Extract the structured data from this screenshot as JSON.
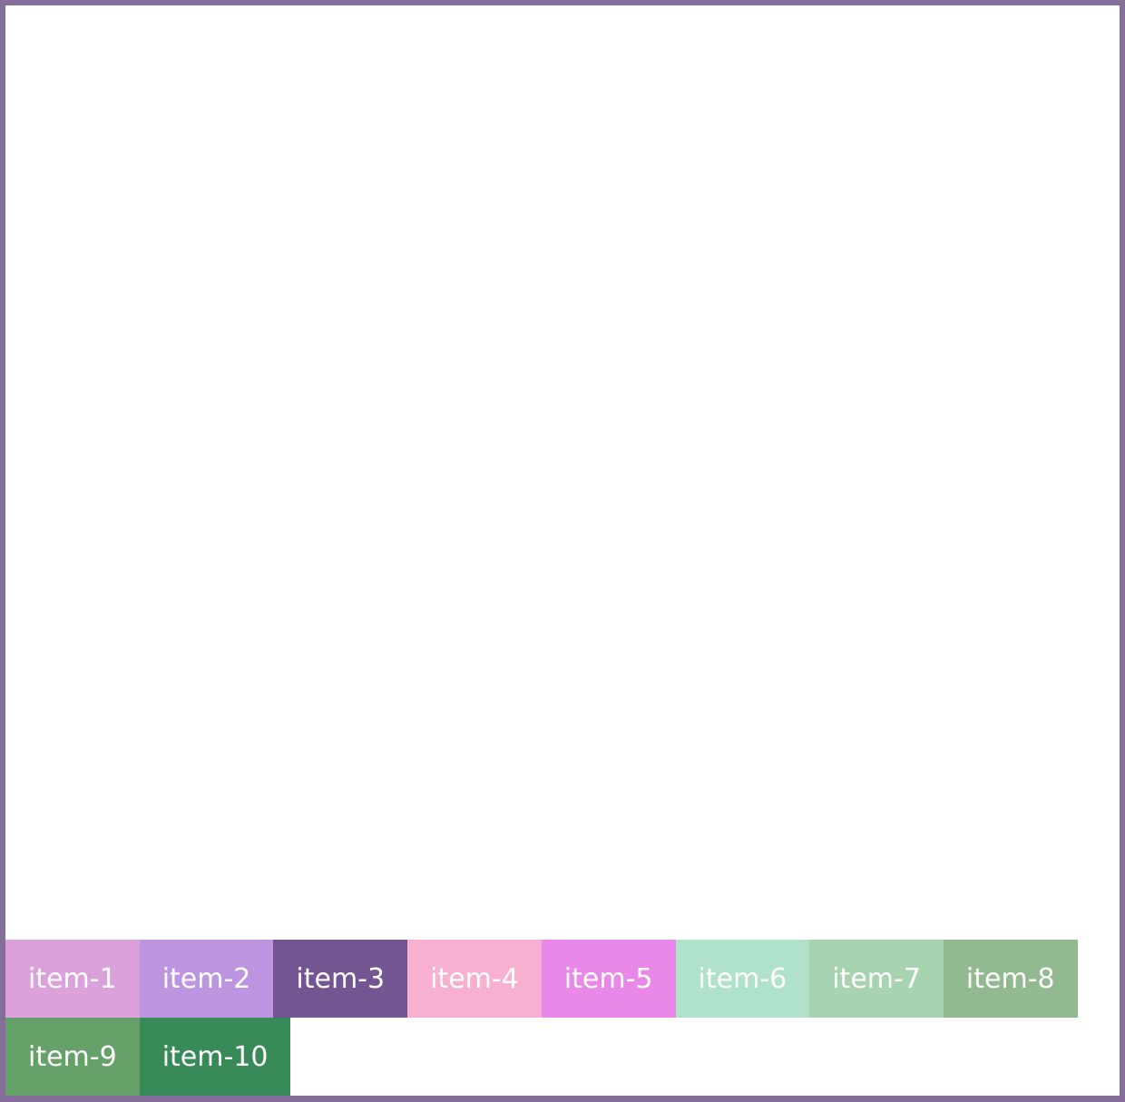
{
  "container": {
    "border_color": "#856e99",
    "background": "#ffffff"
  },
  "items": [
    {
      "label": "item-1",
      "color": "#dba1da"
    },
    {
      "label": "item-2",
      "color": "#bd94e0"
    },
    {
      "label": "item-3",
      "color": "#735592"
    },
    {
      "label": "item-4",
      "color": "#f7b0cf"
    },
    {
      "label": "item-5",
      "color": "#e988e9"
    },
    {
      "label": "item-6",
      "color": "#b0e1ca"
    },
    {
      "label": "item-7",
      "color": "#a7d3b0"
    },
    {
      "label": "item-8",
      "color": "#93b990"
    },
    {
      "label": "item-9",
      "color": "#66a16a"
    },
    {
      "label": "item-10",
      "color": "#388a59"
    }
  ]
}
